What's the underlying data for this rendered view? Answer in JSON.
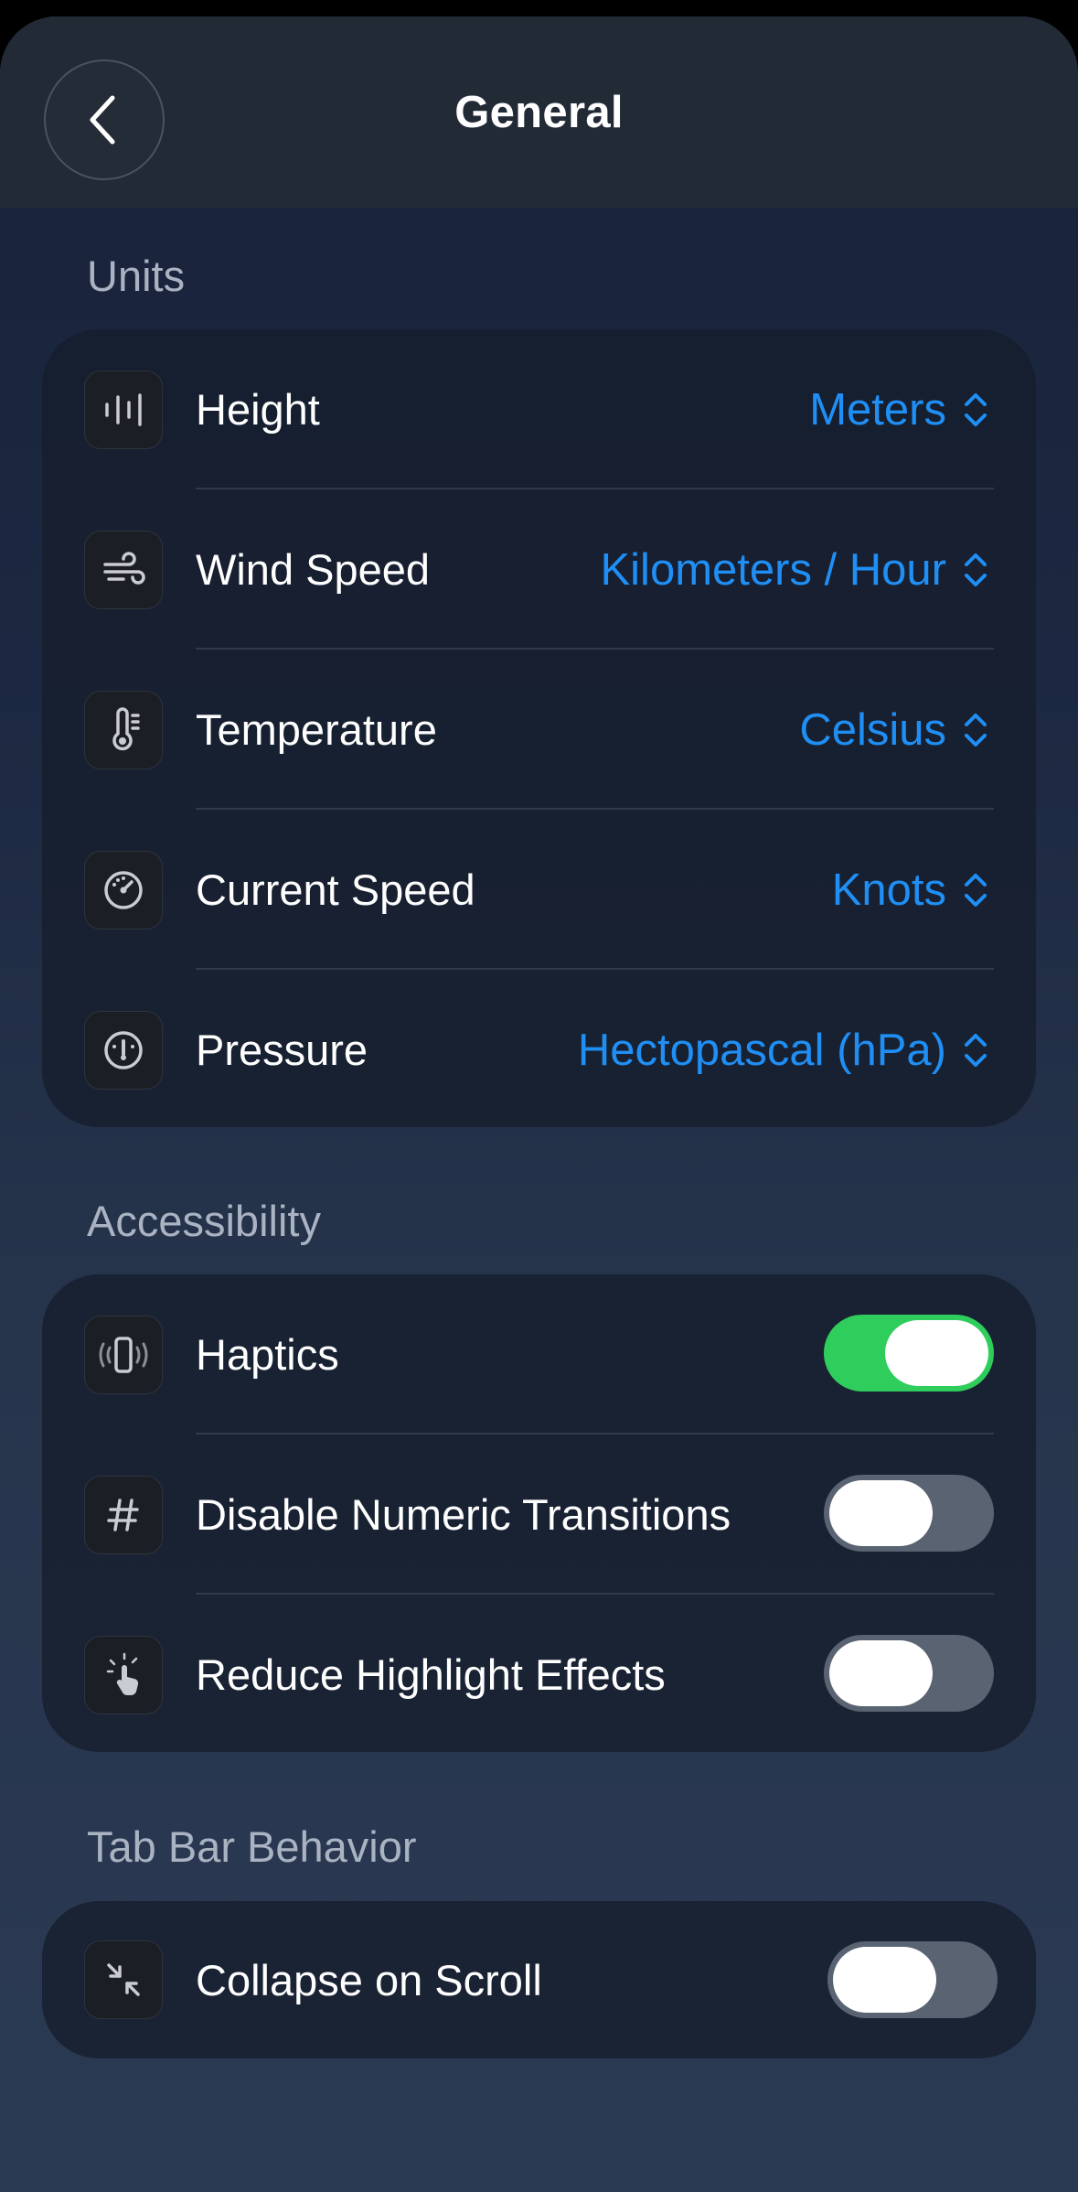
{
  "header": {
    "title": "General",
    "back_label": "Back"
  },
  "colors": {
    "accent": "#1f8ff5",
    "toggle_on": "#2fce5c",
    "toggle_off": "#5a6372"
  },
  "units": {
    "title": "Units",
    "rows": [
      {
        "label": "Height",
        "value": "Meters",
        "icon": "height-icon"
      },
      {
        "label": "Wind Speed",
        "value": "Kilometers / Hour",
        "icon": "wind-icon"
      },
      {
        "label": "Temperature",
        "value": "Celsius",
        "icon": "thermometer-icon"
      },
      {
        "label": "Current Speed",
        "value": "Knots",
        "icon": "speedometer-icon"
      },
      {
        "label": "Pressure",
        "value": "Hectopascal (hPa)",
        "icon": "gauge-icon"
      }
    ]
  },
  "accessibility": {
    "title": "Accessibility",
    "rows": [
      {
        "label": "Haptics",
        "on": true,
        "icon": "phone-vibrate-icon"
      },
      {
        "label": "Disable Numeric Transitions",
        "on": false,
        "icon": "hash-icon"
      },
      {
        "label": "Reduce Highlight Effects",
        "on": false,
        "icon": "hand-tap-icon"
      }
    ]
  },
  "tab_bar": {
    "title": "Tab Bar Behavior",
    "rows": [
      {
        "label": "Collapse on Scroll",
        "on": false,
        "icon": "collapse-arrows-icon"
      }
    ]
  }
}
